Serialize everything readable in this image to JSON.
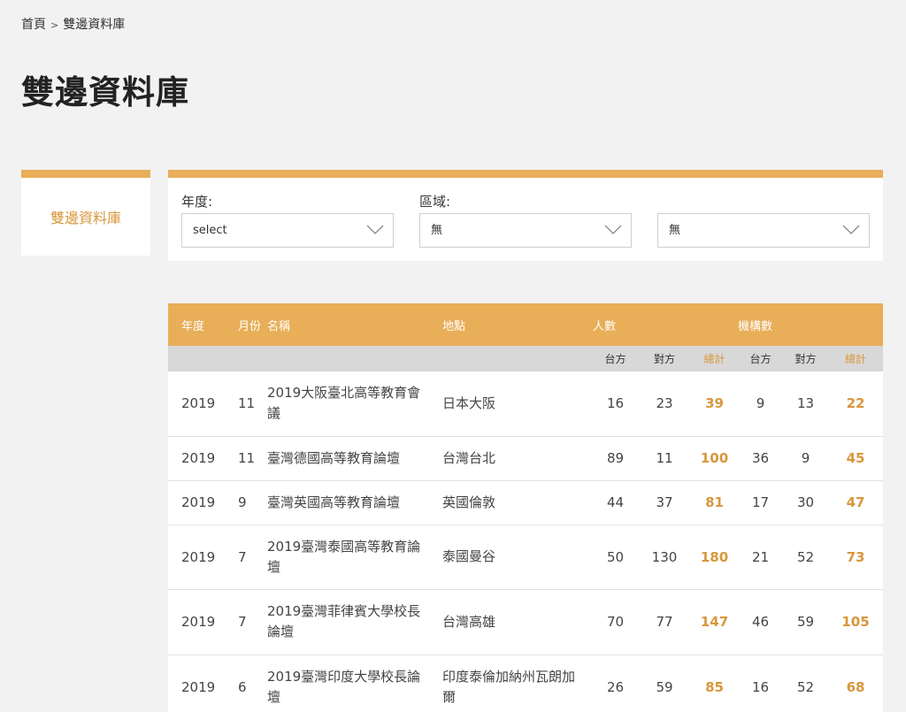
{
  "breadcrumb": {
    "home": "首頁",
    "separator": ">",
    "current": "雙邊資料庫"
  },
  "page_title": "雙邊資料庫",
  "sidebar": {
    "active_item": "雙邊資料庫"
  },
  "filters": {
    "year_label": "年度:",
    "year_value": "select",
    "region_label": "區域:",
    "region_value": "無",
    "sub_region_value": "無"
  },
  "table": {
    "headers": {
      "year": "年度",
      "month": "月份",
      "name": "名稱",
      "location": "地點",
      "people": "人數",
      "institutions": "機構數",
      "taiwan": "台方",
      "partner": "對方",
      "total": "總計"
    },
    "rows": [
      {
        "year": "2019",
        "month": "11",
        "name": "2019大阪臺北高等教育會議",
        "location": "日本大阪",
        "p_tw": "16",
        "p_partner": "23",
        "p_total": "39",
        "i_tw": "9",
        "i_partner": "13",
        "i_total": "22"
      },
      {
        "year": "2019",
        "month": "11",
        "name": "臺灣德國高等教育論壇",
        "location": "台灣台北",
        "p_tw": "89",
        "p_partner": "11",
        "p_total": "100",
        "i_tw": "36",
        "i_partner": "9",
        "i_total": "45"
      },
      {
        "year": "2019",
        "month": "9",
        "name": "臺灣英國高等教育論壇",
        "location": "英國倫敦",
        "p_tw": "44",
        "p_partner": "37",
        "p_total": "81",
        "i_tw": "17",
        "i_partner": "30",
        "i_total": "47"
      },
      {
        "year": "2019",
        "month": "7",
        "name": "2019臺灣泰國高等教育論壇",
        "location": "泰國曼谷",
        "p_tw": "50",
        "p_partner": "130",
        "p_total": "180",
        "i_tw": "21",
        "i_partner": "52",
        "i_total": "73"
      },
      {
        "year": "2019",
        "month": "7",
        "name": "2019臺灣菲律賓大學校長論壇",
        "location": "台灣高雄",
        "p_tw": "70",
        "p_partner": "77",
        "p_total": "147",
        "i_tw": "46",
        "i_partner": "59",
        "i_total": "105"
      },
      {
        "year": "2019",
        "month": "6",
        "name": "2019臺灣印度大學校長論壇",
        "location": "印度泰倫加納州瓦朗加爾",
        "p_tw": "26",
        "p_partner": "59",
        "p_total": "85",
        "i_tw": "16",
        "i_partner": "52",
        "i_total": "68"
      }
    ]
  },
  "colors": {
    "accent": "#e8ae58",
    "accent_text": "#d8973b",
    "background": "#f2f2f2"
  }
}
